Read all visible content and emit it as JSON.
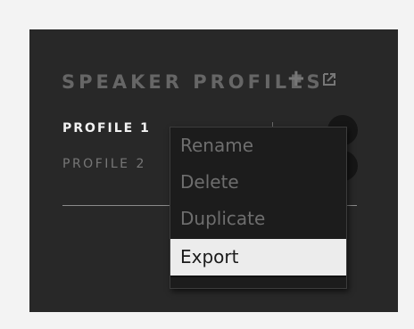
{
  "panel": {
    "title": "SPEAKER PROFILES",
    "add_icon": "plus-icon",
    "export_icon": "export-icon"
  },
  "profiles": [
    {
      "label": "PROFILE 1",
      "active": true
    },
    {
      "label": "PROFILE 2",
      "active": false
    }
  ],
  "context_menu": {
    "items": [
      {
        "label": "Rename",
        "enabled": false
      },
      {
        "label": "Delete",
        "enabled": false
      },
      {
        "label": "Duplicate",
        "enabled": false
      },
      {
        "label": "Export",
        "enabled": true,
        "highlighted": true
      }
    ]
  },
  "colors": {
    "panel_bg": "#282828",
    "menu_bg": "#1c1c1c",
    "highlight_bg": "#ececec",
    "active_text": "#f2f2f2",
    "muted_text": "#666666"
  }
}
